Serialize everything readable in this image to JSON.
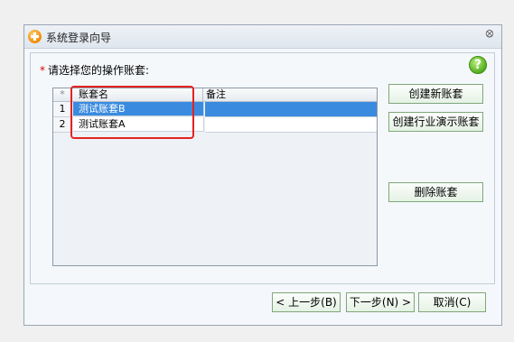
{
  "window": {
    "title": "系统登录向导",
    "close_glyph": "ꕕ"
  },
  "prompt": {
    "required_mark": "*",
    "text": "请选择您的操作账套:"
  },
  "help": {
    "glyph": "?"
  },
  "grid": {
    "headers": {
      "rownum": "*",
      "name": "账套名",
      "note": "备注"
    },
    "rows": [
      {
        "num": "1",
        "name": "测试账套B",
        "note": "",
        "selected": true
      },
      {
        "num": "2",
        "name": "测试账套A",
        "note": "",
        "selected": false
      }
    ]
  },
  "buttons": {
    "create": "创建新账套",
    "create_industry": "创建行业演示账套",
    "delete": "删除账套",
    "prev": "< 上一步(B)",
    "next": "下一步(N) >",
    "cancel": "取消(C)"
  },
  "colors": {
    "selection": "#3a8be0",
    "highlight_box": "#e52222",
    "button_border": "#7fa77a"
  }
}
